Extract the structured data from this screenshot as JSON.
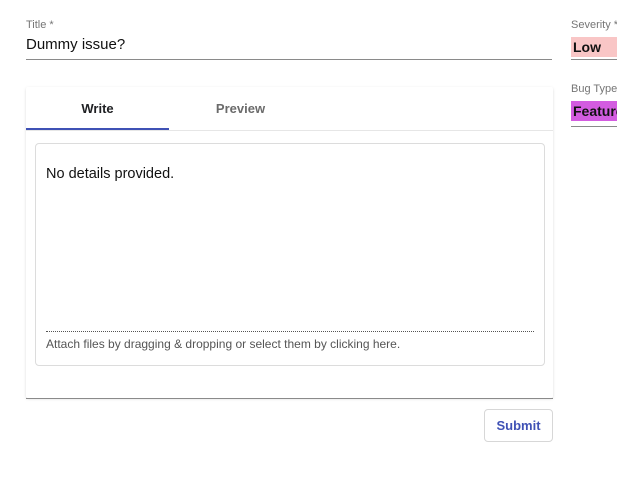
{
  "title_field": {
    "label": "Title *",
    "value": "Dummy issue?"
  },
  "editor": {
    "tabs": [
      {
        "label": "Write",
        "selected": true
      },
      {
        "label": "Preview",
        "selected": false
      }
    ],
    "content": "No details provided.",
    "attach_hint": "Attach files by dragging & dropping or select them by clicking here."
  },
  "submit_label": "Submit",
  "severity": {
    "label": "Severity *",
    "value": "Low",
    "color": "#f9c6c6"
  },
  "bug_type": {
    "label": "Bug Type",
    "value": "Feature",
    "color": "#d35ce0"
  },
  "colors": {
    "accent": "#3f51b5"
  }
}
